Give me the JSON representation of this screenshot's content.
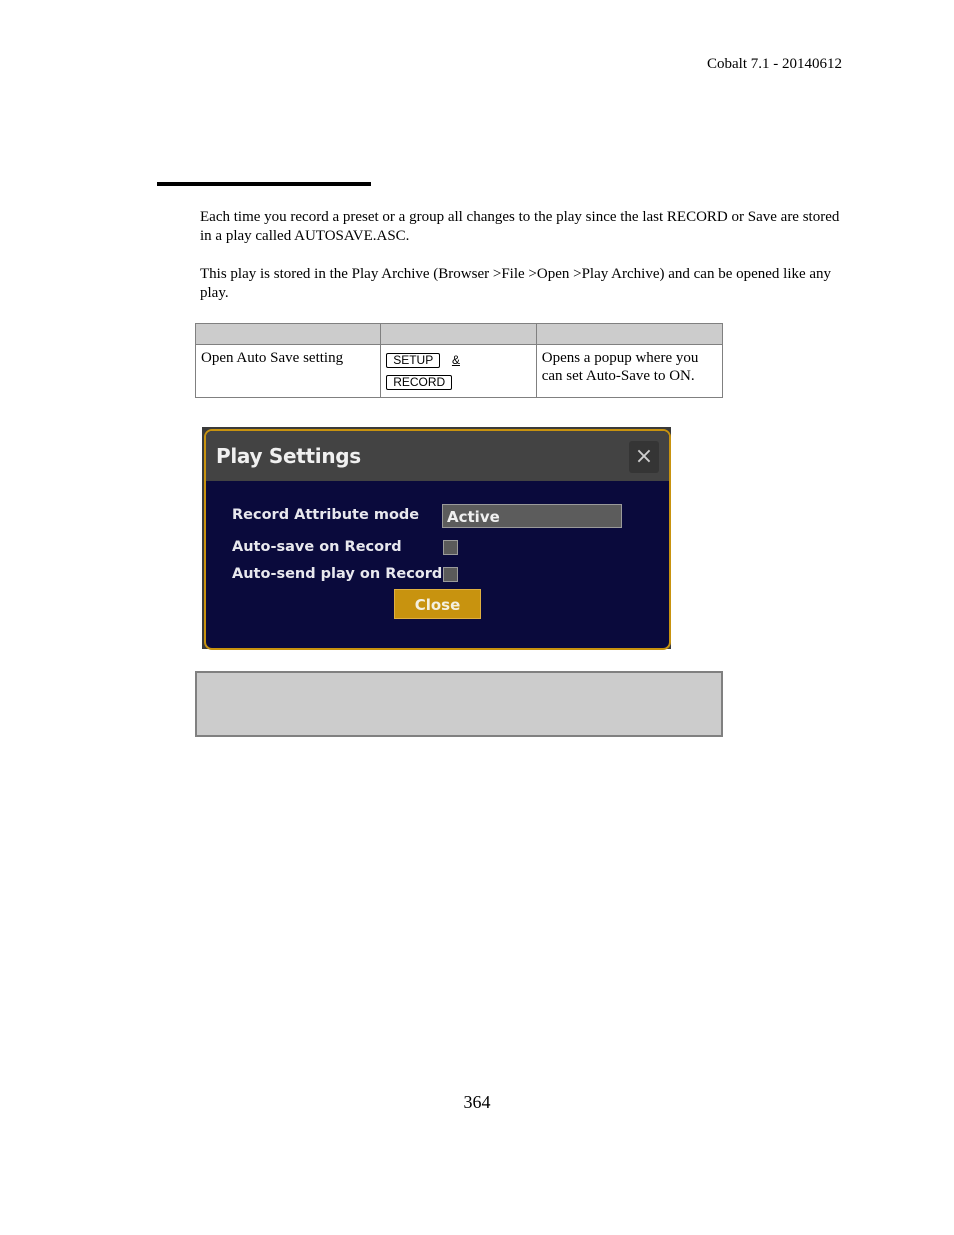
{
  "header": {
    "doc_version": "Cobalt 7.1 - 20140612"
  },
  "body": {
    "paragraphs": [
      "Each time you record a preset or a group all changes to the play since the last RECORD or Save are stored in a play called AUTOSAVE.ASC.",
      "This play is stored in the Play Archive (Browser >File >Open >Play Archive) and can be opened like any play."
    ]
  },
  "command_table": {
    "headers": [
      "",
      "",
      ""
    ],
    "rows": [
      {
        "action": "Open Auto Save setting",
        "keys": [
          "SETUP",
          "RECORD"
        ],
        "key_joiner": "&",
        "result": "Opens a popup where you can set Auto-Save to ON."
      }
    ]
  },
  "screenshot": {
    "dialog_title": "Play Settings",
    "close_icon": "×",
    "fields": [
      {
        "label": "Record Attribute mode",
        "type": "select",
        "value": "Active"
      },
      {
        "label": "Auto-save on Record",
        "type": "checkbox",
        "checked": false
      },
      {
        "label": "Auto-send play on Record",
        "type": "checkbox",
        "checked": false
      }
    ],
    "close_button": "Close",
    "colors": {
      "accent": "#c8930f",
      "background": "#0a0a3c",
      "titlebar": "#434343"
    }
  },
  "note_box": {
    "text": ""
  },
  "footer": {
    "page_number": "364"
  }
}
